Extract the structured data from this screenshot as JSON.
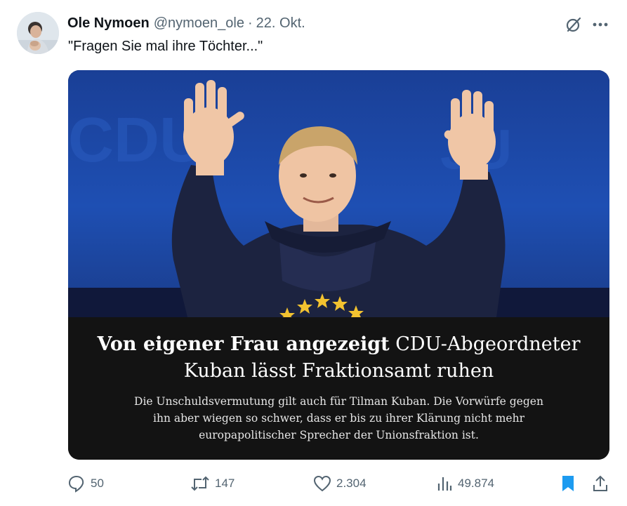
{
  "tweet": {
    "author_name": "Ole Nymoen",
    "handle": "@nymoen_ole",
    "separator": "·",
    "date": "22. Okt.",
    "text": "\"Fragen Sie mal ihre Töchter...\"",
    "avatar_icon": "user-avatar-photo"
  },
  "card": {
    "headline_bold": "Von eigener Frau angezeigt",
    "headline_rest": " CDU-Abgeordneter Kuban lässt Fraktionsamt ruhen",
    "subline": "Die Unschuldsvermutung gilt auch für Tilman Kuban. Die Vorwürfe gegen ihn aber wiegen so schwer, dass er bis zu ihrer Klärung nicht mehr europapolitischer Sprecher der Unionsfraktion ist.",
    "photo_icon": "politician-waving-photo",
    "colors": {
      "stage_blue": "#1d4aa8",
      "caption_bg": "#131313",
      "hoodie_navy": "#1c2340"
    }
  },
  "actions": {
    "replies": "50",
    "reposts": "147",
    "likes": "2.304",
    "views": "49.874",
    "icons": [
      "reply-icon",
      "repost-icon",
      "like-icon",
      "views-icon",
      "bookmark-icon",
      "share-icon"
    ],
    "colors": {
      "muted": "#536471",
      "bookmark": "#1d9bf0"
    }
  },
  "header_icons": [
    "grok-icon",
    "more-icon"
  ]
}
